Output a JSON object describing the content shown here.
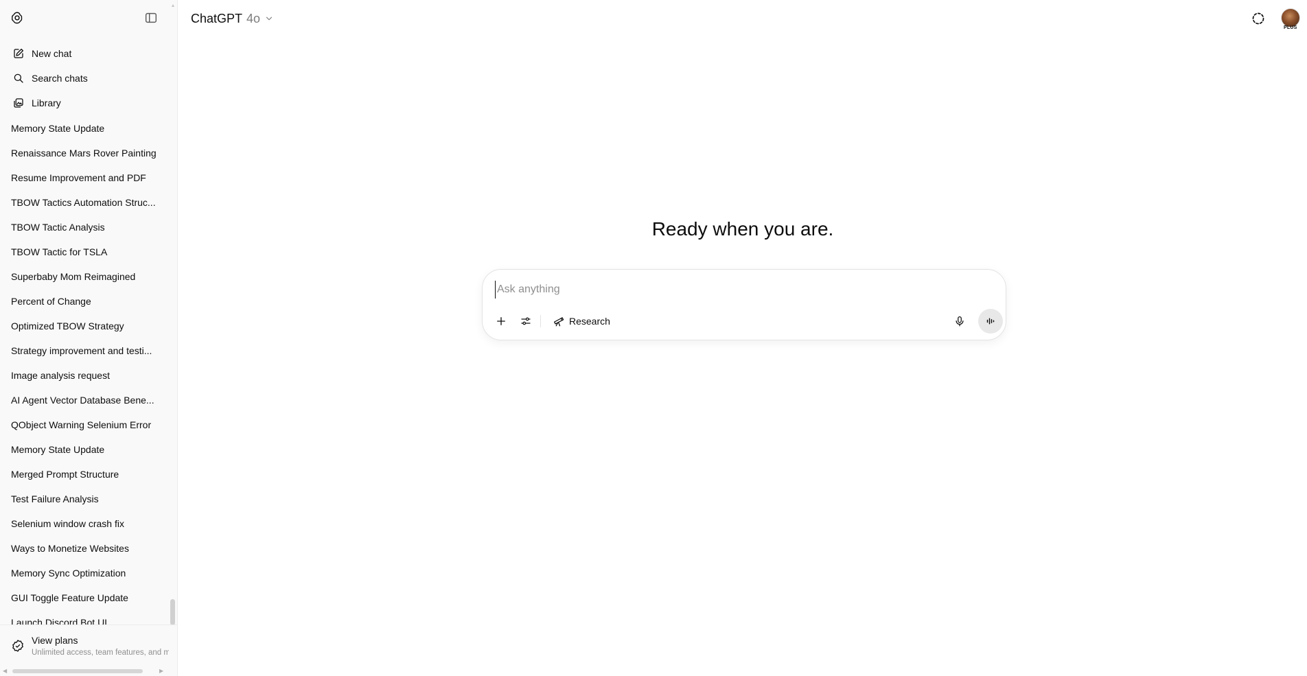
{
  "header": {
    "model_name": "ChatGPT",
    "model_version": "4o",
    "avatar_badge": "PLUS"
  },
  "sidebar": {
    "actions": [
      {
        "label": "New chat",
        "icon": "edit-icon"
      },
      {
        "label": "Search chats",
        "icon": "search-icon"
      },
      {
        "label": "Library",
        "icon": "library-icon"
      }
    ],
    "history": [
      "Memory State Update",
      "Renaissance Mars Rover Painting",
      "Resume Improvement and PDF",
      "TBOW Tactics Automation Struc...",
      "TBOW Tactic Analysis",
      "TBOW Tactic for TSLA",
      "Superbaby Mom Reimagined",
      "Percent of Change",
      "Optimized TBOW Strategy",
      "Strategy improvement and testi...",
      "Image analysis request",
      "AI Agent Vector Database Bene...",
      "QObject Warning Selenium Error",
      "Memory State Update",
      "Merged Prompt Structure",
      "Test Failure Analysis",
      "Selenium window crash fix",
      "Ways to Monetize Websites",
      "Memory Sync Optimization",
      "GUI Toggle Feature Update",
      "Launch Discord Bot UI"
    ],
    "view_plans": {
      "title": "View plans",
      "subtitle": "Unlimited access, team features, and m"
    }
  },
  "main": {
    "hero_text": "Ready when you are.",
    "composer": {
      "placeholder": "Ask anything",
      "research_label": "Research"
    }
  }
}
